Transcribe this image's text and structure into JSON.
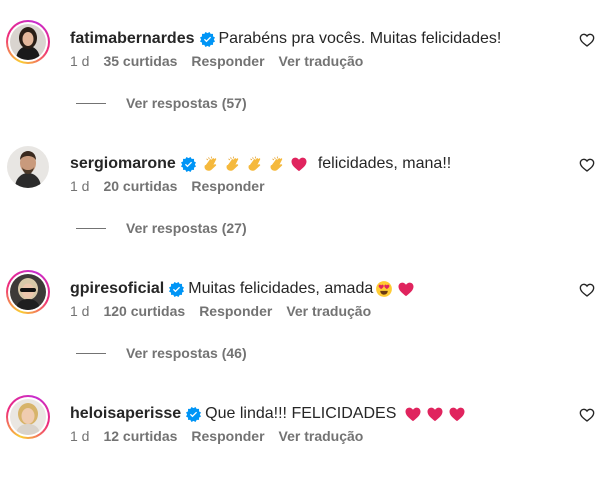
{
  "comments": [
    {
      "username": "fatimabernardes",
      "text": "Parabéns pra vocês. Muitas felicidades!",
      "time": "1 d",
      "likes": "35 curtidas",
      "reply": "Responder",
      "translate": "Ver tradução",
      "view_replies": "Ver respostas (57)"
    },
    {
      "username": "sergiomarone",
      "text": "felicidades, mana!!",
      "emojis": [
        "clapping-hands",
        "clapping-hands",
        "clapping-hands",
        "clapping-hands",
        "red-heart"
      ],
      "time": "1 d",
      "likes": "20 curtidas",
      "reply": "Responder",
      "view_replies": "Ver respostas (27)"
    },
    {
      "username": "gpiresoficial",
      "text": "Muitas felicidades, amada",
      "emojis": [
        "heart-eyes",
        "red-heart"
      ],
      "time": "1 d",
      "likes": "120 curtidas",
      "reply": "Responder",
      "translate": "Ver tradução",
      "view_replies": "Ver respostas (46)"
    },
    {
      "username": "heloisaperisse",
      "text": "Que linda!!! FELICIDADES",
      "emojis": [
        "red-heart",
        "red-heart",
        "red-heart"
      ],
      "time": "1 d",
      "likes": "12 curtidas",
      "reply": "Responder",
      "translate": "Ver tradução"
    }
  ],
  "colors": {
    "verified": "#0095f6",
    "muted": "#737373",
    "heart_emoji": "#e0245e"
  }
}
